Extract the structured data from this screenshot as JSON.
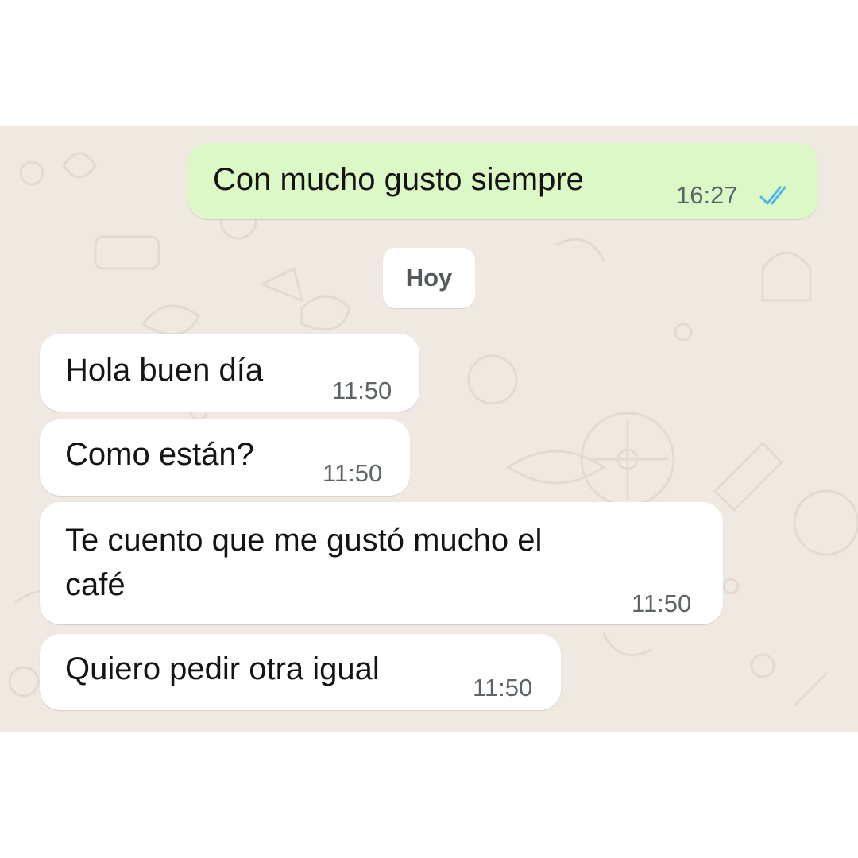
{
  "chat": {
    "outgoing": [
      {
        "text": "Con mucho gusto siempre",
        "time": "16:27",
        "status_icon": "double-check-read-icon",
        "status_color": "#4fb6ec"
      }
    ],
    "date_divider": "Hoy",
    "incoming": [
      {
        "line1": "Hola buen día",
        "time": "11:50"
      },
      {
        "line1": "Como están?",
        "time": "11:50"
      },
      {
        "line1": "Te cuento que me gustó mucho el",
        "line2": "café",
        "time": "11:50"
      },
      {
        "line1": "Quiero pedir otra igual",
        "time": "11:50"
      }
    ]
  },
  "colors": {
    "outgoing_bubble": "#dcf8c6",
    "incoming_bubble": "#ffffff",
    "wallpaper": "#efe9e1"
  }
}
